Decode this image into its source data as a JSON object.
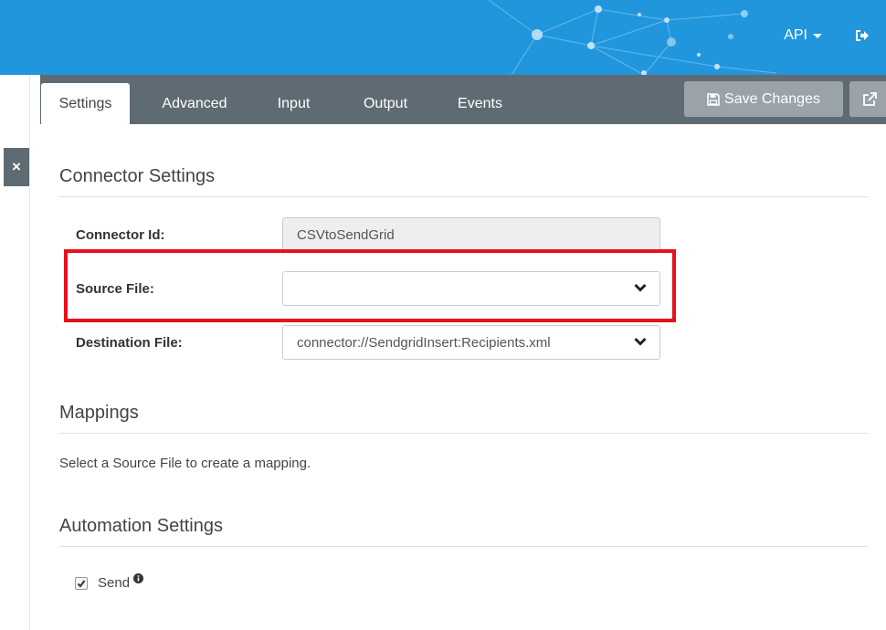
{
  "header": {
    "api_menu_label": "API",
    "brand_color": "#2196dd",
    "logout_icon": "sign-out-icon"
  },
  "sidebar": {
    "close_label": "×"
  },
  "tabs": [
    {
      "label": "Settings",
      "active": true
    },
    {
      "label": "Advanced",
      "active": false
    },
    {
      "label": "Input",
      "active": false
    },
    {
      "label": "Output",
      "active": false
    },
    {
      "label": "Events",
      "active": false
    }
  ],
  "toolbar": {
    "save_label": "Save Changes",
    "save_icon": "floppy-disk-icon",
    "popout_icon": "external-link-icon"
  },
  "connector_settings": {
    "heading": "Connector Settings",
    "connector_id_label": "Connector Id:",
    "connector_id_value": "CSVtoSendGrid",
    "source_file_label": "Source File:",
    "source_file_value": "",
    "destination_file_label": "Destination File:",
    "destination_file_value": "connector://SendgridInsert:Recipients.xml",
    "highlight_color": "#e8101c"
  },
  "mappings": {
    "heading": "Mappings",
    "help_text": "Select a Source File to create a mapping."
  },
  "automation_settings": {
    "heading": "Automation Settings",
    "send_label": "Send",
    "send_checked": true,
    "info_icon": "info-circle-icon"
  }
}
